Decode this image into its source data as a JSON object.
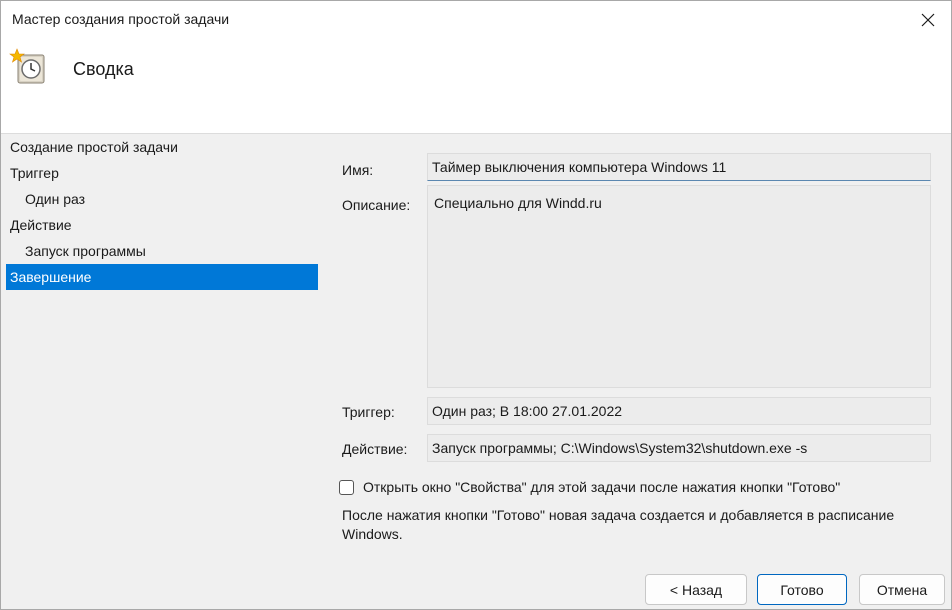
{
  "window": {
    "title": "Мастер создания простой задачи"
  },
  "header": {
    "title": "Сводка",
    "icon": "scheduled-task-clock-icon"
  },
  "nav": {
    "items": [
      {
        "label": "Создание простой задачи",
        "level": 1,
        "selected": false
      },
      {
        "label": "Триггер",
        "level": 1,
        "selected": false
      },
      {
        "label": "Один раз",
        "level": 2,
        "selected": false
      },
      {
        "label": "Действие",
        "level": 1,
        "selected": false
      },
      {
        "label": "Запуск программы",
        "level": 2,
        "selected": false
      },
      {
        "label": "Завершение",
        "level": 1,
        "selected": true
      }
    ]
  },
  "summary": {
    "name_label": "Имя:",
    "name_value": "Таймер выключения компьютера Windows 11",
    "description_label": "Описание:",
    "description_value": "Специально для Windd.ru",
    "trigger_label": "Триггер:",
    "trigger_value": "Один раз; В 18:00 27.01.2022",
    "action_label": "Действие:",
    "action_value": "Запуск программы; C:\\Windows\\System32\\shutdown.exe -s"
  },
  "options": {
    "open_properties_label": "Открыть окно \"Свойства\" для этой задачи после нажатия кнопки \"Готово\"",
    "open_properties_checked": false,
    "note": "После нажатия кнопки \"Готово\" новая задача создается и добавляется в расписание Windows."
  },
  "buttons": {
    "back": "< Назад",
    "finish": "Готово",
    "cancel": "Отмена"
  },
  "colors": {
    "selection": "#0078d7",
    "accent_border": "#0067c0"
  }
}
